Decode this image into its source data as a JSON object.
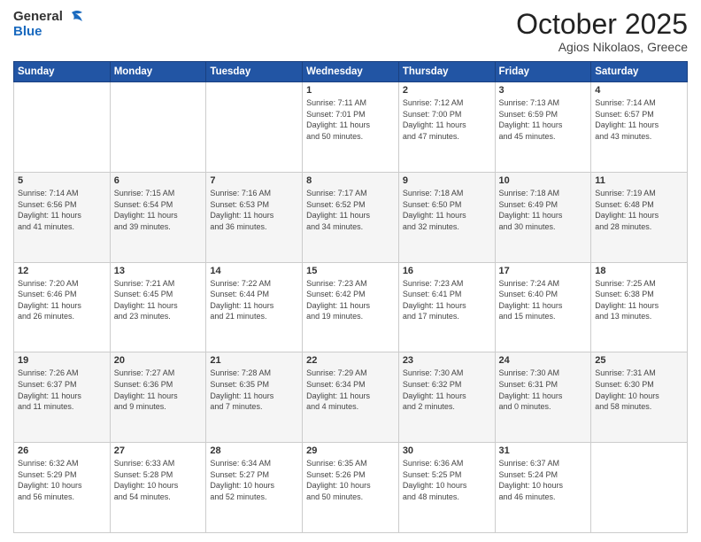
{
  "header": {
    "logo_general": "General",
    "logo_blue": "Blue",
    "month": "October 2025",
    "location": "Agios Nikolaos, Greece"
  },
  "weekdays": [
    "Sunday",
    "Monday",
    "Tuesday",
    "Wednesday",
    "Thursday",
    "Friday",
    "Saturday"
  ],
  "weeks": [
    [
      {
        "day": "",
        "info": ""
      },
      {
        "day": "",
        "info": ""
      },
      {
        "day": "",
        "info": ""
      },
      {
        "day": "1",
        "info": "Sunrise: 7:11 AM\nSunset: 7:01 PM\nDaylight: 11 hours\nand 50 minutes."
      },
      {
        "day": "2",
        "info": "Sunrise: 7:12 AM\nSunset: 7:00 PM\nDaylight: 11 hours\nand 47 minutes."
      },
      {
        "day": "3",
        "info": "Sunrise: 7:13 AM\nSunset: 6:59 PM\nDaylight: 11 hours\nand 45 minutes."
      },
      {
        "day": "4",
        "info": "Sunrise: 7:14 AM\nSunset: 6:57 PM\nDaylight: 11 hours\nand 43 minutes."
      }
    ],
    [
      {
        "day": "5",
        "info": "Sunrise: 7:14 AM\nSunset: 6:56 PM\nDaylight: 11 hours\nand 41 minutes."
      },
      {
        "day": "6",
        "info": "Sunrise: 7:15 AM\nSunset: 6:54 PM\nDaylight: 11 hours\nand 39 minutes."
      },
      {
        "day": "7",
        "info": "Sunrise: 7:16 AM\nSunset: 6:53 PM\nDaylight: 11 hours\nand 36 minutes."
      },
      {
        "day": "8",
        "info": "Sunrise: 7:17 AM\nSunset: 6:52 PM\nDaylight: 11 hours\nand 34 minutes."
      },
      {
        "day": "9",
        "info": "Sunrise: 7:18 AM\nSunset: 6:50 PM\nDaylight: 11 hours\nand 32 minutes."
      },
      {
        "day": "10",
        "info": "Sunrise: 7:18 AM\nSunset: 6:49 PM\nDaylight: 11 hours\nand 30 minutes."
      },
      {
        "day": "11",
        "info": "Sunrise: 7:19 AM\nSunset: 6:48 PM\nDaylight: 11 hours\nand 28 minutes."
      }
    ],
    [
      {
        "day": "12",
        "info": "Sunrise: 7:20 AM\nSunset: 6:46 PM\nDaylight: 11 hours\nand 26 minutes."
      },
      {
        "day": "13",
        "info": "Sunrise: 7:21 AM\nSunset: 6:45 PM\nDaylight: 11 hours\nand 23 minutes."
      },
      {
        "day": "14",
        "info": "Sunrise: 7:22 AM\nSunset: 6:44 PM\nDaylight: 11 hours\nand 21 minutes."
      },
      {
        "day": "15",
        "info": "Sunrise: 7:23 AM\nSunset: 6:42 PM\nDaylight: 11 hours\nand 19 minutes."
      },
      {
        "day": "16",
        "info": "Sunrise: 7:23 AM\nSunset: 6:41 PM\nDaylight: 11 hours\nand 17 minutes."
      },
      {
        "day": "17",
        "info": "Sunrise: 7:24 AM\nSunset: 6:40 PM\nDaylight: 11 hours\nand 15 minutes."
      },
      {
        "day": "18",
        "info": "Sunrise: 7:25 AM\nSunset: 6:38 PM\nDaylight: 11 hours\nand 13 minutes."
      }
    ],
    [
      {
        "day": "19",
        "info": "Sunrise: 7:26 AM\nSunset: 6:37 PM\nDaylight: 11 hours\nand 11 minutes."
      },
      {
        "day": "20",
        "info": "Sunrise: 7:27 AM\nSunset: 6:36 PM\nDaylight: 11 hours\nand 9 minutes."
      },
      {
        "day": "21",
        "info": "Sunrise: 7:28 AM\nSunset: 6:35 PM\nDaylight: 11 hours\nand 7 minutes."
      },
      {
        "day": "22",
        "info": "Sunrise: 7:29 AM\nSunset: 6:34 PM\nDaylight: 11 hours\nand 4 minutes."
      },
      {
        "day": "23",
        "info": "Sunrise: 7:30 AM\nSunset: 6:32 PM\nDaylight: 11 hours\nand 2 minutes."
      },
      {
        "day": "24",
        "info": "Sunrise: 7:30 AM\nSunset: 6:31 PM\nDaylight: 11 hours\nand 0 minutes."
      },
      {
        "day": "25",
        "info": "Sunrise: 7:31 AM\nSunset: 6:30 PM\nDaylight: 10 hours\nand 58 minutes."
      }
    ],
    [
      {
        "day": "26",
        "info": "Sunrise: 6:32 AM\nSunset: 5:29 PM\nDaylight: 10 hours\nand 56 minutes."
      },
      {
        "day": "27",
        "info": "Sunrise: 6:33 AM\nSunset: 5:28 PM\nDaylight: 10 hours\nand 54 minutes."
      },
      {
        "day": "28",
        "info": "Sunrise: 6:34 AM\nSunset: 5:27 PM\nDaylight: 10 hours\nand 52 minutes."
      },
      {
        "day": "29",
        "info": "Sunrise: 6:35 AM\nSunset: 5:26 PM\nDaylight: 10 hours\nand 50 minutes."
      },
      {
        "day": "30",
        "info": "Sunrise: 6:36 AM\nSunset: 5:25 PM\nDaylight: 10 hours\nand 48 minutes."
      },
      {
        "day": "31",
        "info": "Sunrise: 6:37 AM\nSunset: 5:24 PM\nDaylight: 10 hours\nand 46 minutes."
      },
      {
        "day": "",
        "info": ""
      }
    ]
  ]
}
